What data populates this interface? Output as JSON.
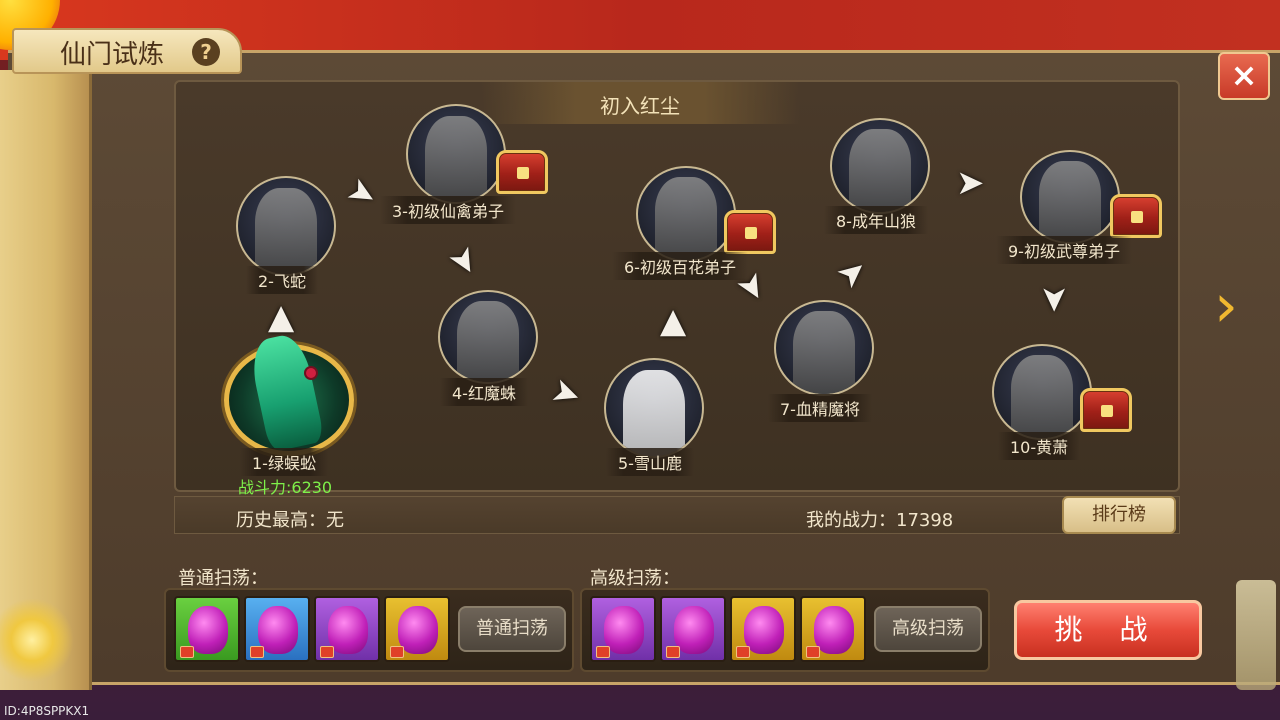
{
  "title": "仙门试炼",
  "help_icon": "question-icon",
  "close_icon": "close-icon",
  "stage_title": "初入红尘",
  "nodes": [
    {
      "label": "1-绿蜈蚣"
    },
    {
      "label": "2-飞蛇"
    },
    {
      "label": "3-初级仙禽弟子"
    },
    {
      "label": "4-红魔蛛"
    },
    {
      "label": "5-雪山鹿"
    },
    {
      "label": "6-初级百花弟子"
    },
    {
      "label": "7-血精魔将"
    },
    {
      "label": "8-成年山狼"
    },
    {
      "label": "9-初级武尊弟子"
    },
    {
      "label": "10-黄萧"
    }
  ],
  "current_power": "战斗力:6230",
  "history_best": "历史最高：无",
  "my_power": "我的战力：17398",
  "rank_button": "排行榜",
  "normal_sweep": {
    "label": "普通扫荡：",
    "button": "普通扫荡"
  },
  "advanced_sweep": {
    "label": "高级扫荡：",
    "button": "高级扫荡"
  },
  "challenge_button": "挑 战",
  "footer_id": "ID:4P8SPPKX1",
  "colors": {
    "accent_gold": "#e8b848",
    "power_green": "#7ef04a",
    "challenge_red": "#e84a3a"
  }
}
